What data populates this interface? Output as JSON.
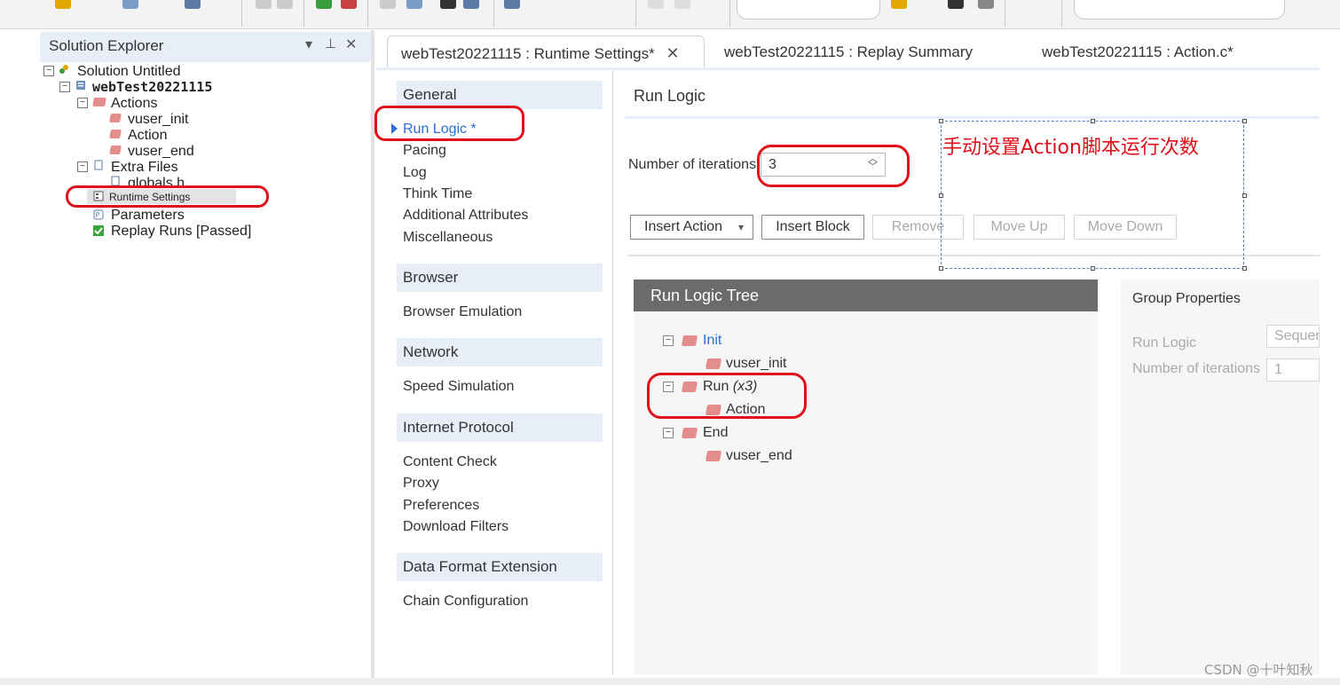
{
  "solution_explorer": {
    "title": "Solution Explorer",
    "controls": {
      "dropdown": "▾",
      "pin": "⊥",
      "close": "✕"
    },
    "tree": {
      "solution": "Solution Untitled",
      "project": "webTest20221115",
      "actions_folder": "Actions",
      "actions": [
        "vuser_init",
        "Action",
        "vuser_end"
      ],
      "extra_files_folder": "Extra Files",
      "extra_file": "globals.h",
      "runtime_settings": "Runtime Settings",
      "parameters": "Parameters",
      "replay_runs": "Replay Runs [Passed]"
    }
  },
  "tabs": [
    {
      "label": "webTest20221115 : Runtime Settings*",
      "active": true
    },
    {
      "label": "webTest20221115 : Replay Summary",
      "active": false
    },
    {
      "label": "webTest20221115 : Action.c*",
      "active": false
    }
  ],
  "tab_close": "✕",
  "nav": {
    "general": {
      "label": "General",
      "items": [
        "Run Logic *",
        "Pacing",
        "Log",
        "Think Time",
        "Additional Attributes",
        "Miscellaneous"
      ]
    },
    "browser": {
      "label": "Browser",
      "items": [
        "Browser Emulation"
      ]
    },
    "network": {
      "label": "Network",
      "items": [
        "Speed Simulation"
      ]
    },
    "internet_protocol": {
      "label": "Internet Protocol",
      "items": [
        "Content Check",
        "Proxy",
        "Preferences",
        "Download Filters"
      ]
    },
    "data_format": {
      "label": "Data Format Extension",
      "items": [
        "Chain Configuration"
      ]
    }
  },
  "content": {
    "title": "Run Logic",
    "iterations_label": "Number of iterations",
    "iterations_value": "3",
    "buttons": {
      "insert_action": "Insert Action",
      "insert_block": "Insert Block",
      "remove": "Remove",
      "move_up": "Move Up",
      "move_down": "Move Down"
    }
  },
  "run_logic_tree": {
    "title": "Run Logic Tree",
    "init": "Init",
    "init_child": "vuser_init",
    "run": "Run",
    "run_suffix": "(x3)",
    "run_child": "Action",
    "end": "End",
    "end_child": "vuser_end"
  },
  "group_properties": {
    "title": "Group Properties",
    "run_logic_label": "Run Logic",
    "run_logic_value": "Sequential",
    "iterations_label": "Number of iterations",
    "iterations_value": "1"
  },
  "annotation": {
    "note": "手动设置Action脚本运行次数",
    "color": "#e0101a"
  },
  "watermark": "CSDN @十叶知秋",
  "colors": {
    "accent_blue": "#2a6fd1",
    "nav_group_bg": "#e8eef7",
    "tree_header_bg": "#6b6b6b",
    "brick": "#e38d8d"
  }
}
